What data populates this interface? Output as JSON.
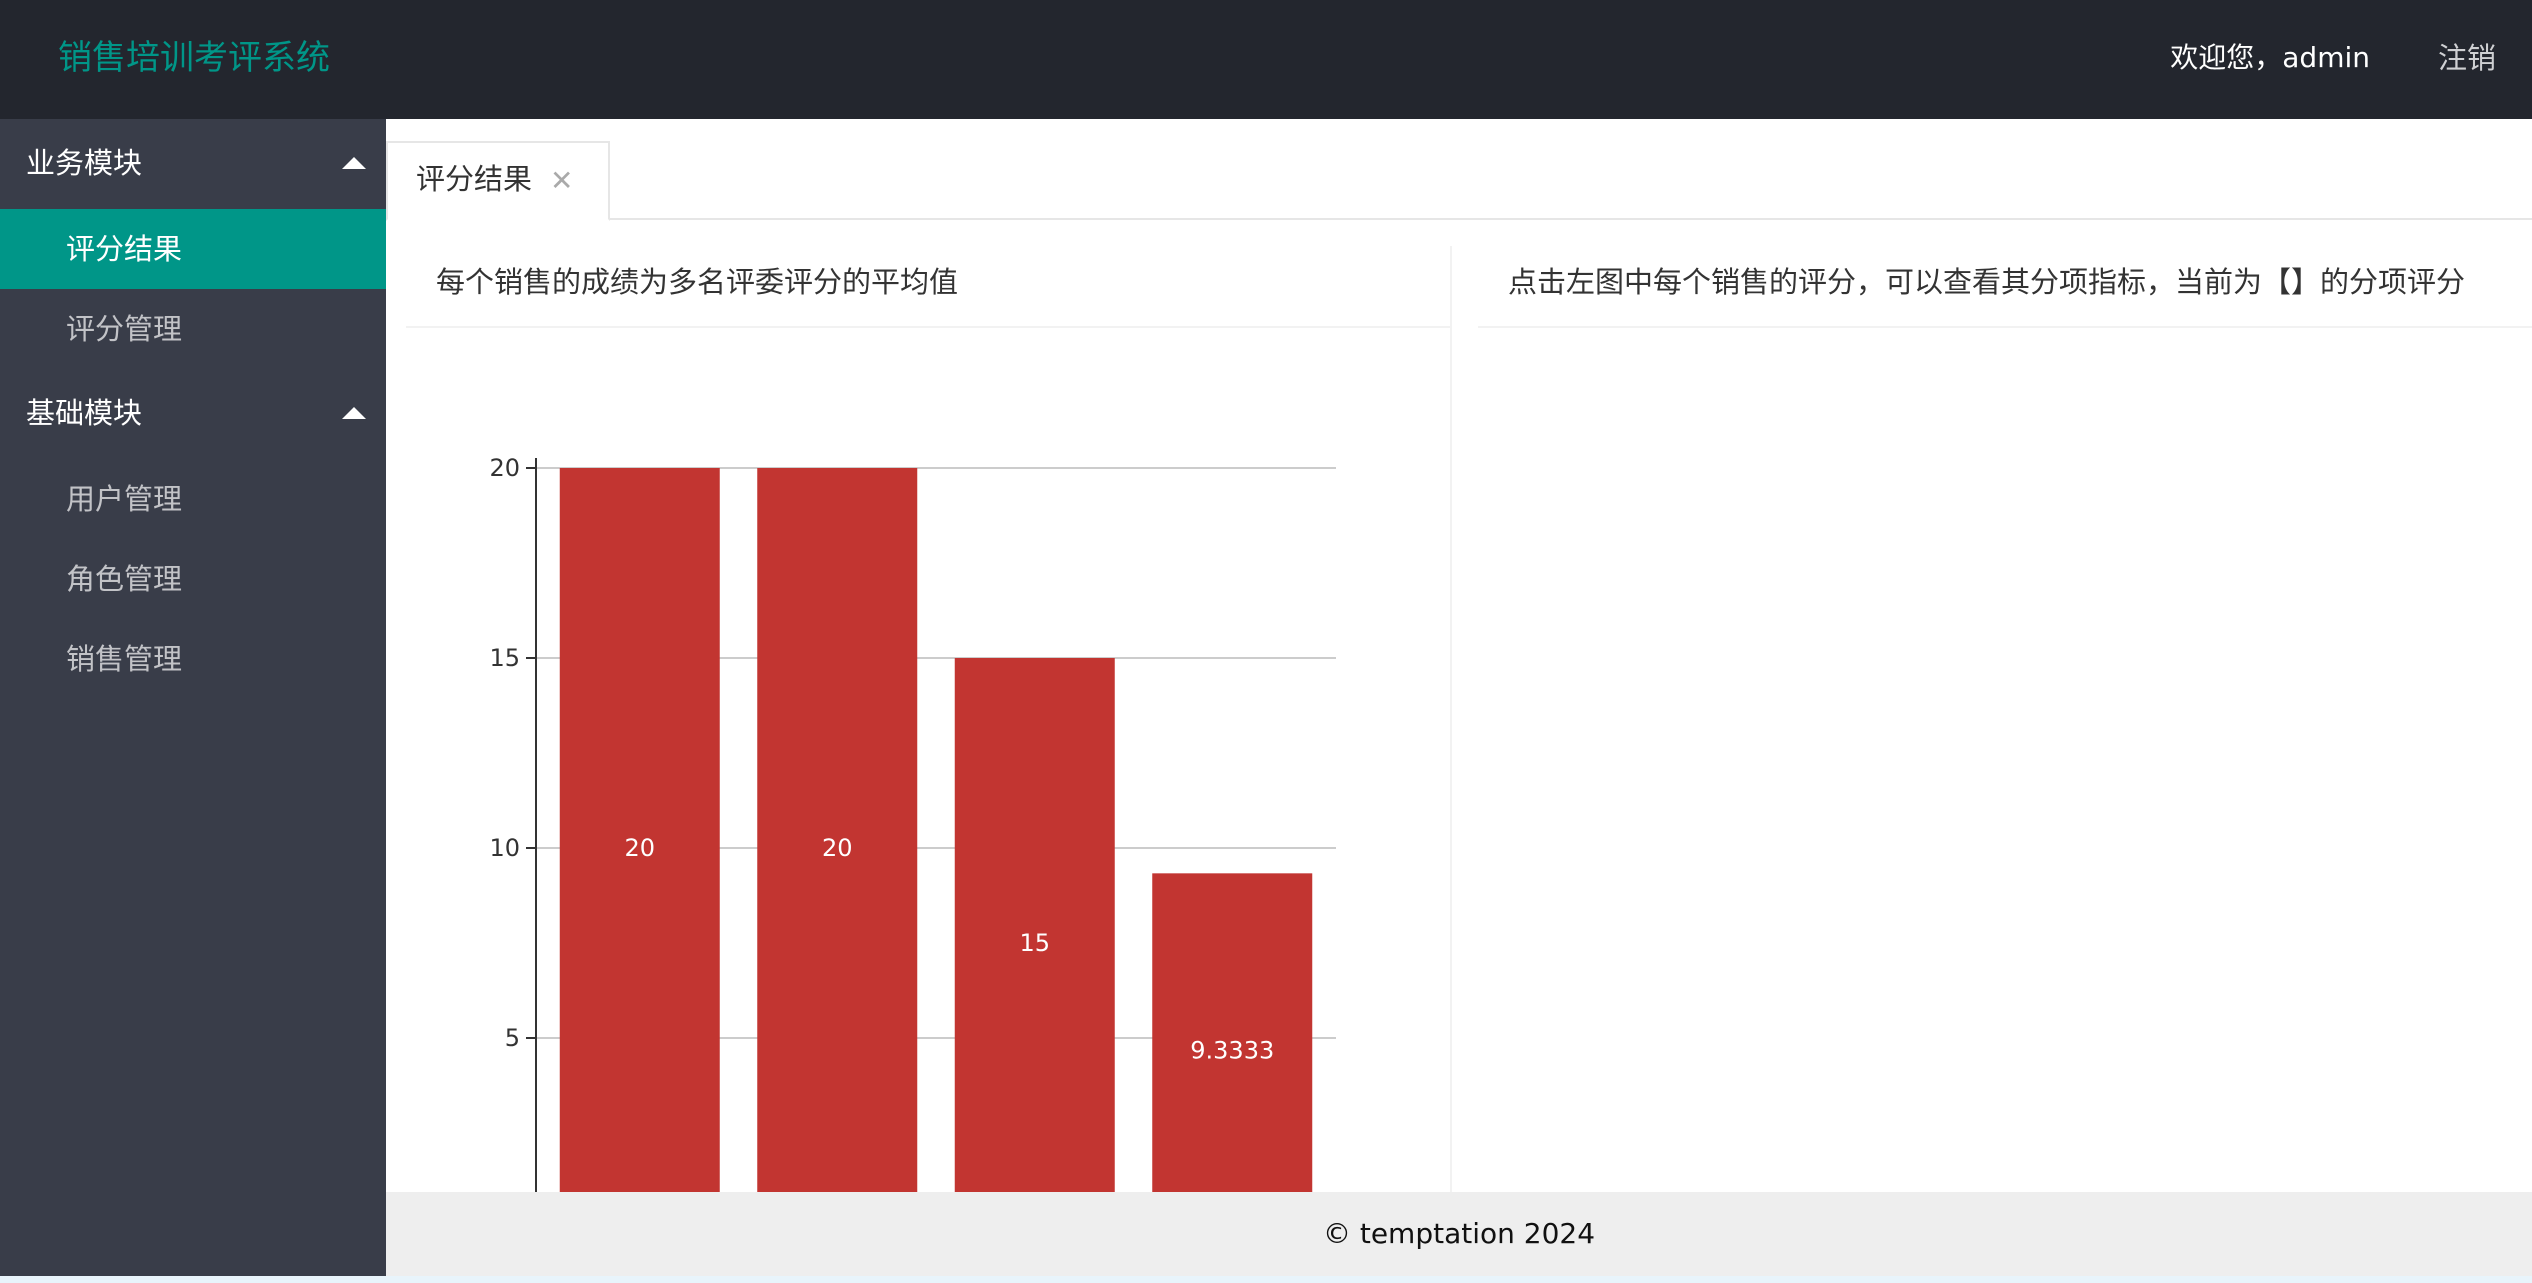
{
  "header": {
    "app_title": "销售培训考评系统",
    "welcome": "欢迎您，admin",
    "logout": "注销"
  },
  "sidebar": {
    "groups": [
      {
        "label": "业务模块",
        "items": [
          {
            "label": "评分结果",
            "active": true
          },
          {
            "label": "评分管理",
            "active": false
          }
        ]
      },
      {
        "label": "基础模块",
        "items": [
          {
            "label": "用户管理",
            "active": false
          },
          {
            "label": "角色管理",
            "active": false
          },
          {
            "label": "销售管理",
            "active": false
          }
        ]
      }
    ]
  },
  "tabs": [
    {
      "label": "评分结果",
      "close": "✕"
    }
  ],
  "left_card": {
    "title": "每个销售的成绩为多名评委评分的平均值"
  },
  "right_card": {
    "title": "点击左图中每个销售的评分，可以查看其分项指标，当前为【】的分项评分"
  },
  "chart_data": {
    "type": "bar",
    "title": "",
    "xlabel": "",
    "ylabel": "",
    "yticks": [
      5,
      10,
      15,
      20
    ],
    "ylim": [
      0,
      20
    ],
    "values": [
      20,
      20,
      15,
      9.3333
    ],
    "value_labels": [
      "20",
      "20",
      "15",
      "9.3333"
    ],
    "bar_color": "#c23531",
    "grid": true
  },
  "footer": {
    "text": "© temptation 2024"
  },
  "colors": {
    "header_bg": "#23262e",
    "sidebar_bg": "#393d49",
    "accent": "#009688",
    "footer_bg": "#eeeeee"
  }
}
